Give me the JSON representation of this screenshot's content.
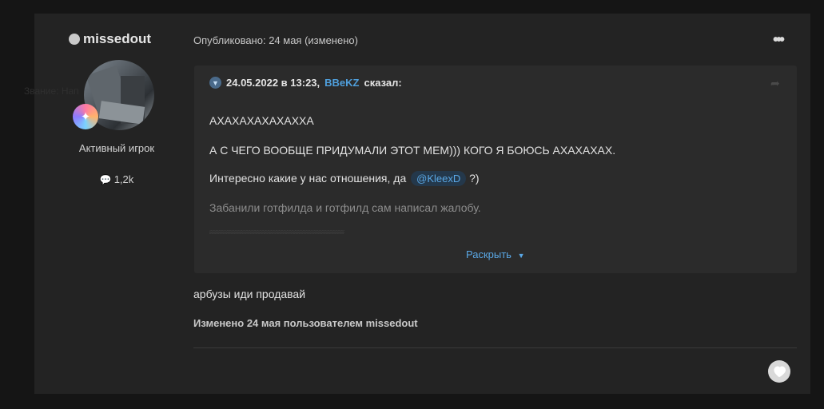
{
  "author": {
    "name": "missedout",
    "rank_title": "Активный игрок",
    "post_count": "1,2k",
    "ghost_label": "Звание: Нап"
  },
  "post": {
    "published": "Опубликовано: 24 мая (изменено)",
    "more_label": "•••",
    "reply_text": "арбузы иди продавай",
    "edited_note": "Изменено 24 мая пользователем missedout"
  },
  "quote": {
    "date": "24.05.2022 в 13:23,",
    "user": "BBeKZ",
    "said": "сказал:",
    "lines": [
      "АХАХАХАХАХАХХА",
      "А С ЧЕГО ВООБЩЕ ПРИДУМАЛИ ЭТОТ МЕМ))) КОГО Я БОЮСЬ АХАХАХАХ.",
      "Интересно какие у нас отношения, да",
      "Забанили готфилда и готфилд сам написал жалобу."
    ],
    "mention": "@KleexD",
    "mention_suffix": "?)",
    "expand_label": "Раскрыть"
  },
  "colors": {
    "accent": "#5aa8e6",
    "background": "#151515",
    "panel": "#232323",
    "quote_bg": "#2b2b2b"
  },
  "icons": [
    "status-dot-icon",
    "rank-badge-icon",
    "speech-bubble-icon",
    "chevron-down-icon",
    "share-icon",
    "ellipsis-icon",
    "heart-icon"
  ]
}
